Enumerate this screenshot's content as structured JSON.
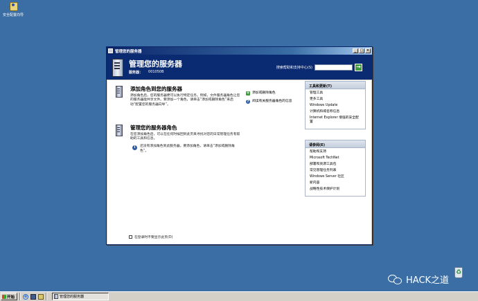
{
  "desktop": {
    "icon_label": "安全配置向导"
  },
  "window": {
    "titlebar": "管理您的服务器",
    "header_title": "管理您的服务器",
    "server_label": "服务器：",
    "server_name": "001050B",
    "search_label": "搜索帮助和支持中心(S)",
    "search_value": "",
    "go_label": "→"
  },
  "sections": [
    {
      "title": "添加角色到您的服务器",
      "desc": "添加角色后，您的服务器便可以执行特定任务。例如，文件服务器角色让您的服务器能共享文件。要添加一个角色，请单击“添加或删除角色”来启动“配置您的服务器向导”。"
    },
    {
      "title": "管理您的服务器角色",
      "desc": "在您添加角色后，可以在任何时候回到此页来寻找对您的日常管理任务有帮助的工具和信息。"
    }
  ],
  "info_text": "还没有添加角色到此服务器。要添加角色，请单击“添加或删除角色”。",
  "actions": [
    {
      "label": "添加或删除角色",
      "icon": "add-icon"
    },
    {
      "label": "阅读有关服务器角色的信息",
      "icon": "help-icon"
    }
  ],
  "tools_panel": {
    "title": "工具和更新(T)",
    "items": [
      "管理工具",
      "更多工具",
      "Windows Update",
      "计算机和域名称信息",
      "Internet Explorer 增强的安全配置"
    ]
  },
  "see_also_panel": {
    "title": "请参阅(E)",
    "items": [
      "帮助和支持",
      "Microsoft TechNet",
      "部署和资源工具包",
      "常见管理任务列表",
      "Windows Server 社区",
      "新内容",
      "战略性技术保护计划"
    ]
  },
  "footer": {
    "checkbox_label": "在登录时不要显示此页(D)"
  },
  "taskbar": {
    "start_label": "开始",
    "task_label": "管理您的服务器"
  },
  "watermark": {
    "text": "HACK之道"
  },
  "colors": {
    "desktop": "#3a6ea5",
    "title_bar": "#0a246a",
    "header": "#0a2a72",
    "panel_border": "#a8b4c8"
  }
}
